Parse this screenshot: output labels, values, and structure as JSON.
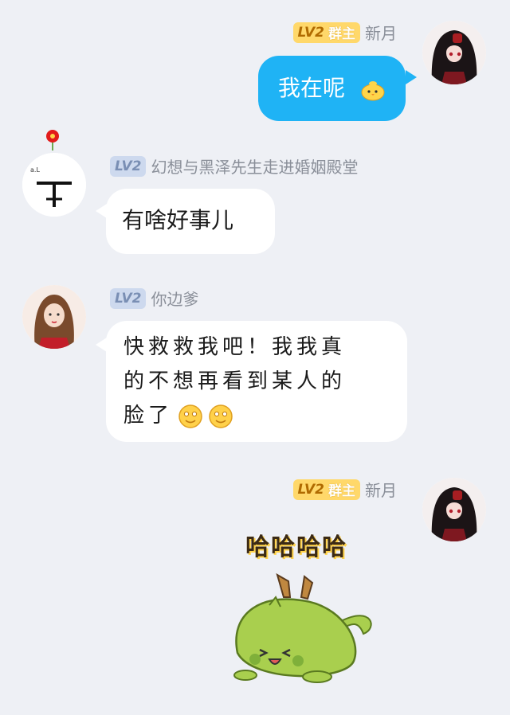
{
  "messages": [
    {
      "badge": "LV2",
      "role": "群主",
      "sender": "新月",
      "text": "我在呢"
    },
    {
      "badge": "LV2",
      "sender": "幻想与黑泽先生走进婚姻殿堂",
      "text": "有啥好事儿"
    },
    {
      "badge": "LV2",
      "sender": "你边爹",
      "lines": [
        "快救救我吧！我我真",
        "的不想再看到某人的",
        "脸了"
      ]
    },
    {
      "badge": "LV2",
      "role": "群主",
      "sender": "新月",
      "sticker_text": "哈哈哈哈"
    }
  ],
  "icons": [
    "avatar-anime-girl",
    "avatar-calligraphy",
    "avatar-portrait",
    "chick-emoji",
    "smile-emoji",
    "green-dragon-sticker"
  ],
  "colors": {
    "background": "#eef0f5",
    "my_bubble": "#1fb3f5",
    "other_bubble": "#ffffff",
    "owner_badge": "#ffd86a",
    "level_badge": "#cdd9ee"
  }
}
